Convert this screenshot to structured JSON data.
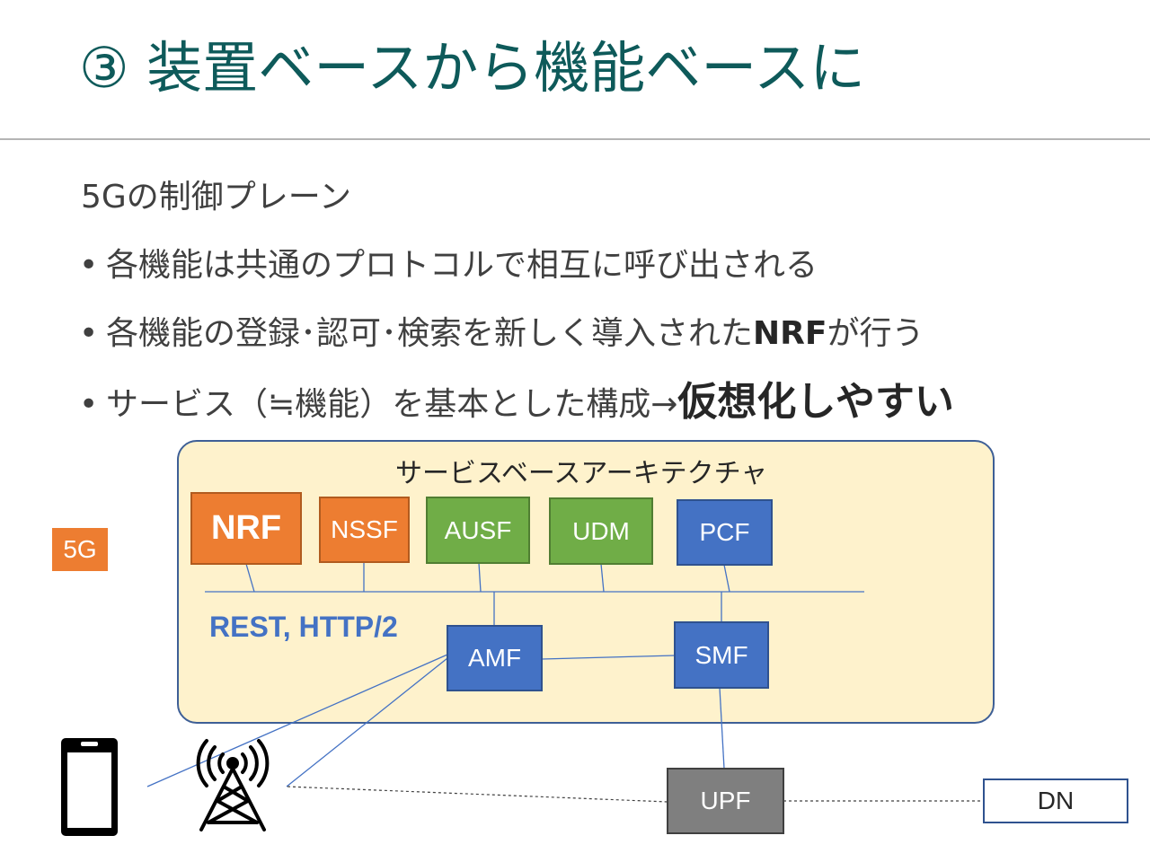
{
  "title": "③ 装置ベースから機能ベースに",
  "subtitle": "5Gの制御プレーン",
  "bullets": [
    {
      "text": "各機能は共通のプロトコルで相互に呼び出される"
    },
    {
      "prefix": "各機能の登録･認可･検索を新しく導入された",
      "bold": "NRF",
      "suffix": "が行う"
    },
    {
      "prefix": "サービス（≒機能）を基本とした構成→",
      "bold": "仮想化しやすい"
    }
  ],
  "bullet_char": "•",
  "side_label": "5G",
  "architecture": {
    "title": "サービスベースアーキテクチャ",
    "protocol_label": "REST, HTTP/2",
    "functions": {
      "nrf": "NRF",
      "nssf": "NSSF",
      "ausf": "AUSF",
      "udm": "UDM",
      "pcf": "PCF",
      "amf": "AMF",
      "smf": "SMF"
    }
  },
  "user_plane": {
    "upf": "UPF",
    "dn": "DN"
  },
  "icons": {
    "device": "smartphone-icon",
    "antenna": "cell-tower-icon"
  },
  "colors": {
    "title": "#0e5a5a",
    "orange": "#ed7d31",
    "green": "#70ad47",
    "blue": "#4472c4",
    "gray": "#7f7f7f",
    "panel": "#fef2cc"
  }
}
